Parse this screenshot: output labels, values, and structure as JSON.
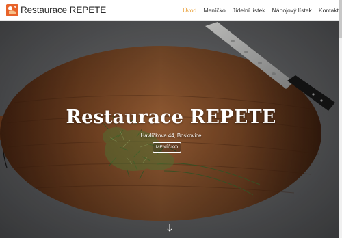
{
  "brand": {
    "name": "Restaurace REPETE",
    "logo_icon": "repete-logo",
    "logo_color": "#e8632a"
  },
  "nav": {
    "active_color": "#e9a13a",
    "items": [
      {
        "label": "Úvod",
        "active": true
      },
      {
        "label": "Meníčko",
        "active": false
      },
      {
        "label": "Jídelní lístek",
        "active": false
      },
      {
        "label": "Nápojový lístek",
        "active": false
      },
      {
        "label": "Kontakt",
        "active": false
      }
    ]
  },
  "hero": {
    "title": "Restaurace REPETE",
    "address": "Havlíčkova 44, Boskovice",
    "button_label": "MENÍČKO",
    "background_image": "cutting-board-with-dill-and-knife",
    "scroll_icon": "arrow-down-icon"
  }
}
